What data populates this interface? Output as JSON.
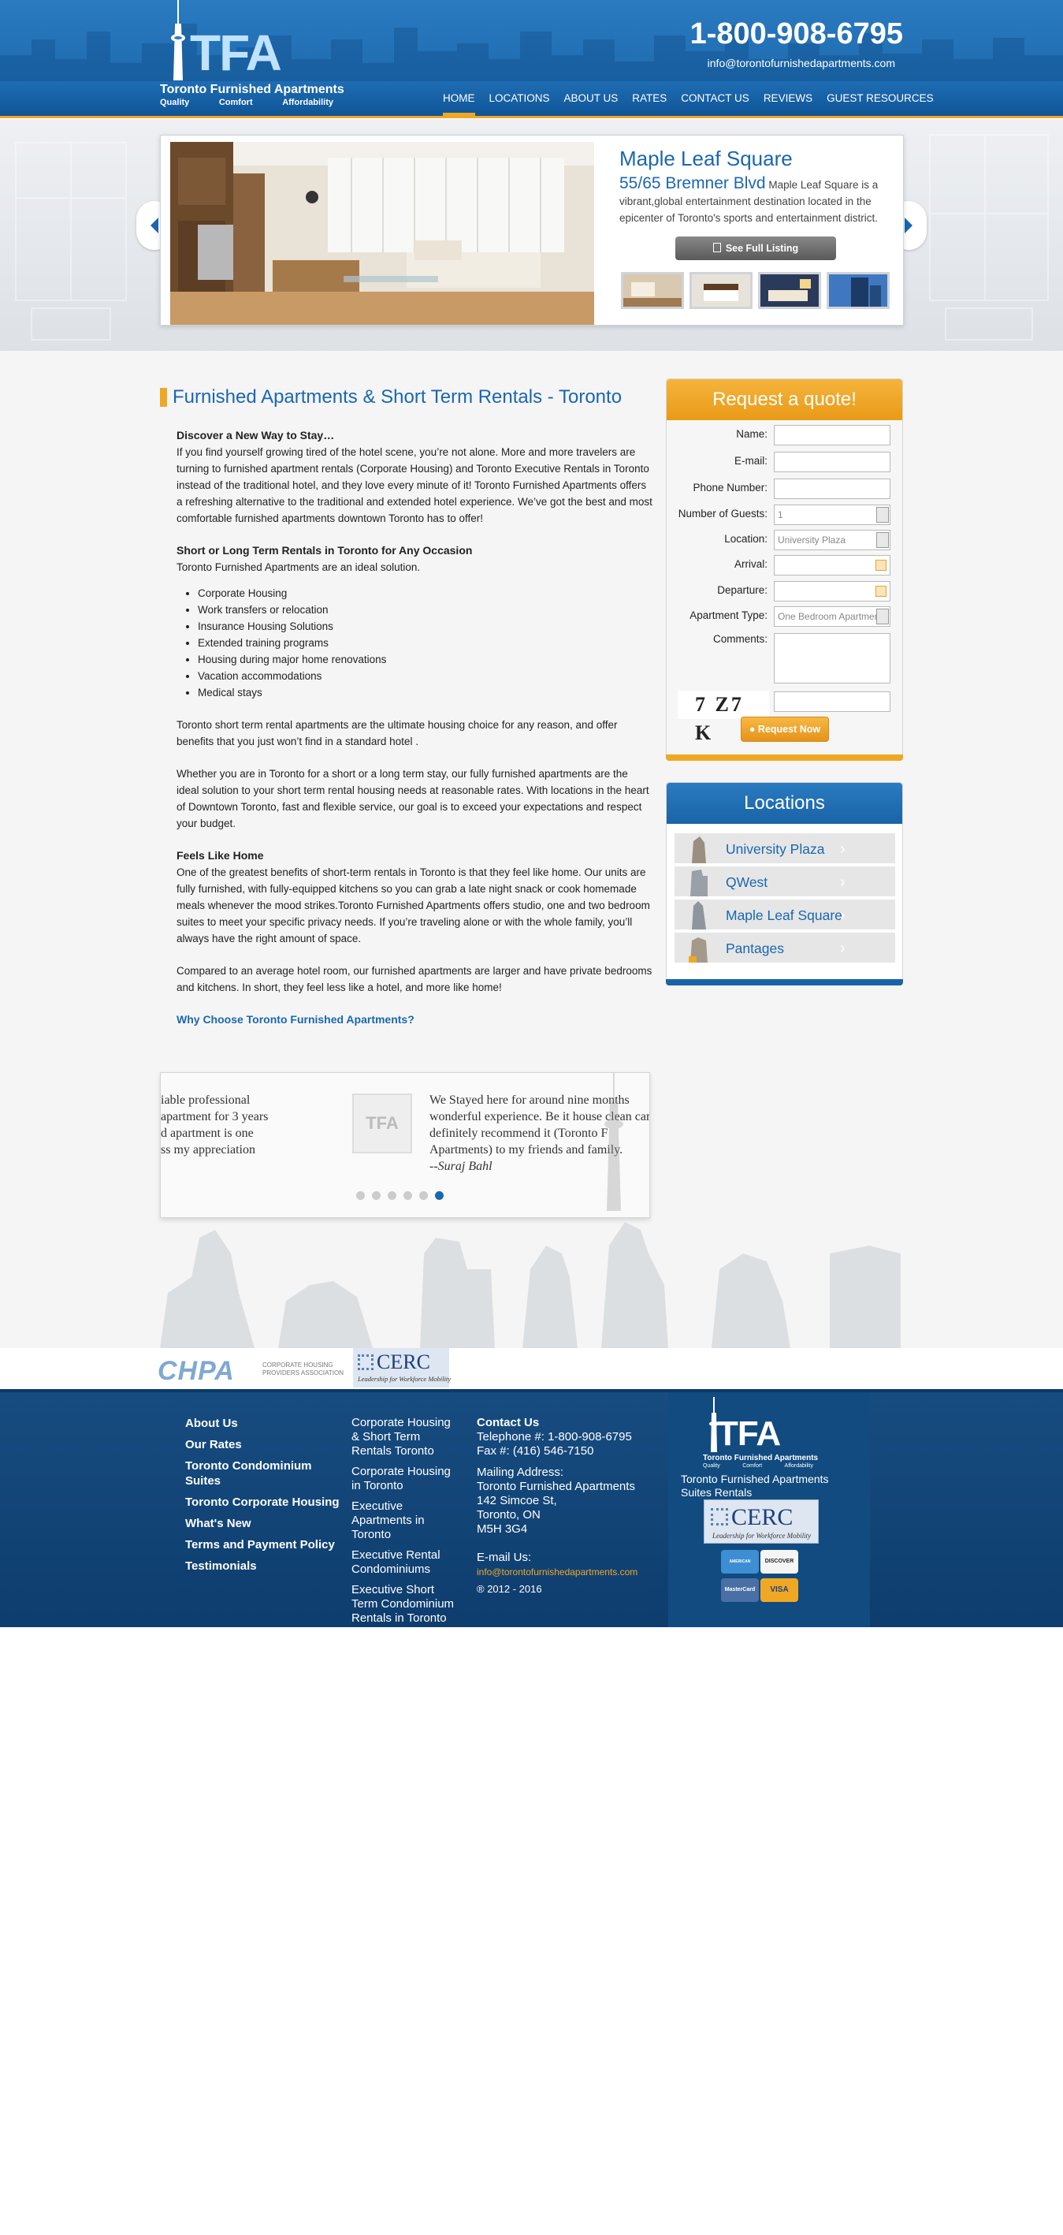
{
  "colors": {
    "brand_blue": "#1a67b0",
    "accent_orange": "#f0a824",
    "footer_blue": "#0e3d6e"
  },
  "header": {
    "logo_text": "TFA",
    "logo_name": "Toronto Furnished Apartments",
    "logo_tags": [
      "Quality",
      "Comfort",
      "Affordability"
    ],
    "phone": "1-800-908-6795",
    "email": "info@torontofurnishedapartments.com"
  },
  "nav": [
    {
      "label": "HOME",
      "active": true
    },
    {
      "label": "LOCATIONS"
    },
    {
      "label": "ABOUT US"
    },
    {
      "label": "RATES"
    },
    {
      "label": "CONTACT US"
    },
    {
      "label": "REVIEWS"
    },
    {
      "label": "GUEST RESOURCES"
    }
  ],
  "slider": {
    "title": "Maple Leaf Square",
    "street": "55/65 Bremner Blvd",
    "description": "Maple Leaf Square is a vibrant,global entertainment destination located in the epicenter of Toronto's sports and entertainment district.",
    "button": "See Full Listing",
    "prev_icon": "chevron-left-icon",
    "next_icon": "chevron-right-icon"
  },
  "main": {
    "heading": "Furnished Apartments & Short Term Rentals - Toronto",
    "s1_title": "Discover a New Way to Stay…",
    "s1_body": "If you find yourself growing tired of the hotel scene, you’re not alone. More and more travelers are turning to furnished apartment rentals (Corporate Housing) and Toronto Executive Rentals in Toronto instead of the traditional hotel, and they love every minute of it! Toronto Furnished Apartments offers a refreshing alternative to the traditional and extended hotel experience. We’ve got the best and most comfortable furnished apartments downtown Toronto has to offer!",
    "s2_title": "Short or Long Term Rentals in Toronto for Any Occasion",
    "s2_body": "Toronto Furnished Apartments are an ideal solution.",
    "occasions": [
      "Corporate Housing",
      "Work transfers or relocation",
      "Insurance Housing Solutions",
      "Extended training programs",
      "Housing during major home renovations",
      "Vacation accommodations",
      "Medical stays"
    ],
    "p3": "Toronto short term rental apartments are the ultimate housing choice for any reason, and offer benefits that you just won’t find in a standard hotel .",
    "p4": "Whether you are in Toronto for a short or a long term stay, our fully furnished apartments are the ideal solution to your short term rental housing needs at reasonable rates. With locations in the heart of Downtown Toronto, fast and flexible service, our goal is to exceed your expectations and respect your budget.",
    "s5_title": "Feels Like Home",
    "s5_body": "One of the greatest benefits of short-term rentals in Toronto is that they feel like home. Our units are fully furnished, with fully-equipped kitchens so you can grab a late night snack or cook homemade meals whenever the mood strikes.Toronto Furnished Apartments offers studio, one and two bedroom suites to meet your specific privacy needs. If you’re traveling alone or with the whole family, you’ll always have the right amount of space.",
    "p6": "Compared to an average hotel room, our furnished apartments are larger and have private bedrooms and kitchens. In short, they feel less like a hotel, and more like home!",
    "why_link": "Why Choose Toronto Furnished Apartments?"
  },
  "testimonials": {
    "left_partial": "iable professional\napartment for 3 years\nd apartment is one\nss my appreciation",
    "logo_text": "TFA",
    "quote": "We Stayed here for around nine months wonderful experience. Be it house clean can definitely recommend it (Toronto F Apartments) to my friends and family.",
    "author": "--Suraj Bahl",
    "dots": 6,
    "active_dot": 6
  },
  "quote_form": {
    "title": "Request a quote!",
    "fields": {
      "name": "Name:",
      "email": "E-mail:",
      "phone": "Phone Number:",
      "guests": "Number of Guests:",
      "location": "Location:",
      "arrival": "Arrival:",
      "departure": "Departure:",
      "apt_type": "Apartment Type:",
      "comments": "Comments:"
    },
    "guests_value": "1",
    "location_value": "University Plaza",
    "apt_type_value": "One Bedroom Apartment",
    "captcha_text": "7 Z7 K",
    "submit": "Request Now"
  },
  "locations": {
    "title": "Locations",
    "items": [
      "University Plaza",
      "QWest",
      "Maple Leaf Square",
      "Pantages"
    ]
  },
  "partners": {
    "chpa": "CHPA",
    "chpa_sub": "CORPORATE HOUSING\nPROVIDERS ASSOCIATION",
    "cerc": "CERC",
    "cerc_sub": "Leadership for Workforce Mobility"
  },
  "footer": {
    "col1": [
      "About Us",
      "Our Rates",
      "Toronto Condominium Suites",
      "Toronto Corporate Housing",
      "What's New",
      "Terms and Payment Policy",
      "Testimonials"
    ],
    "col2": [
      "Corporate Housing & Short Term Rentals Toronto",
      "Corporate Housing in Toronto",
      "Executive Apartments in Toronto",
      "Executive Rental Condominiums",
      "Executive Short Term Condominium Rentals in Toronto"
    ],
    "contact_title": "Contact Us",
    "telephone": "Telephone #: 1-800-908-6795",
    "fax": "Fax #: (416) 546-7150",
    "mailing_label": "Mailing Address:",
    "address1": "Toronto Furnished Apartments",
    "address2": "142 Simcoe St,",
    "address3": "Toronto, ON",
    "address4": "M5H 3G4",
    "email_label": "E-mail Us:",
    "email": "info@torontofurnishedapartments.com",
    "copyright": "® 2012 - 2016",
    "right_tagline": "Toronto Furnished Apartments Suites Rentals",
    "cards": [
      "AMERICAN EXPRESS",
      "DISCOVER",
      "MasterCard",
      "VISA"
    ]
  }
}
